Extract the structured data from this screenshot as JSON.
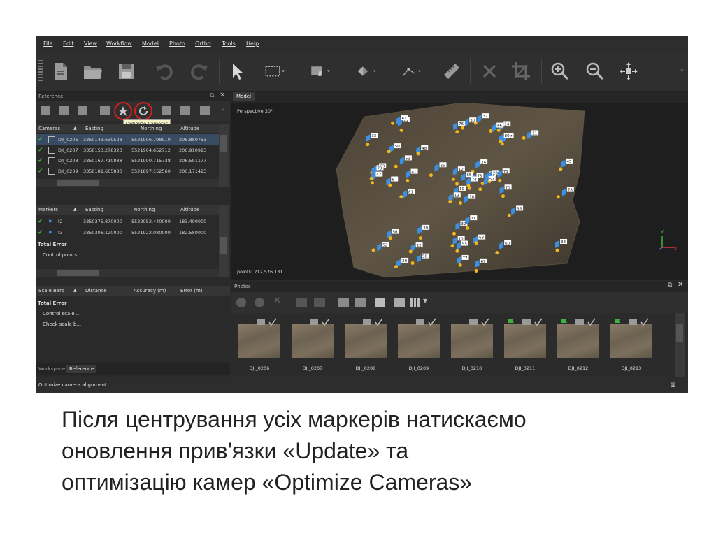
{
  "menu": [
    "File",
    "Edit",
    "View",
    "Workflow",
    "Model",
    "Photo",
    "Ortho",
    "Tools",
    "Help"
  ],
  "toolbar": {
    "icons": [
      "new-document-icon",
      "open-folder-icon",
      "save-icon",
      "undo-icon",
      "redo-icon",
      "navigation-arrow-icon",
      "rectangle-selection-icon",
      "intelligent-scissors-icon",
      "move-object-icon",
      "draw-polyline-icon",
      "ruler-icon",
      "delete-icon",
      "crop-icon",
      "zoom-in-icon",
      "zoom-out-icon",
      "reset-view-icon"
    ]
  },
  "reference_panel": {
    "title": "Reference",
    "tooltip": "Optimize Cameras",
    "cameras": {
      "headers": [
        "Cameras",
        "Easting",
        "Northing",
        "Altitude"
      ],
      "rows": [
        {
          "name": "DJI_0206",
          "easting": "3350143.639528",
          "northing": "5521906.798910",
          "altitude": "206.880753"
        },
        {
          "name": "DJI_0207",
          "easting": "3350153.278323",
          "northing": "5521904.652712",
          "altitude": "206.910923"
        },
        {
          "name": "DJI_0208",
          "easting": "3350167.710888",
          "northing": "5521900.715738",
          "altitude": "206.591177"
        },
        {
          "name": "DJI_0209",
          "easting": "3350181.665880",
          "northing": "5521897.152560",
          "altitude": "206.171423"
        }
      ]
    },
    "markers": {
      "headers": [
        "Markers",
        "Easting",
        "Northing",
        "Altitude"
      ],
      "rows": [
        {
          "name": "t2",
          "easting": "3350375.870000",
          "northing": "5522052.440000",
          "altitude": "183.400000"
        },
        {
          "name": "t3",
          "easting": "3350306.120000",
          "northing": "5521922.080000",
          "altitude": "182.580000"
        }
      ],
      "total_error": "Total Error",
      "control_points": "Control points"
    },
    "scalebars": {
      "headers": [
        "Scale Bars",
        "Distance",
        "Accuracy (m)",
        "Error (m)"
      ],
      "total_error": "Total Error",
      "control_scale": "Control scale ...",
      "check_scale": "Check scale b..."
    },
    "tabs": [
      "Workspace",
      "Reference"
    ]
  },
  "model": {
    "tab": "Model",
    "view_label": "Perspective 30°",
    "points": "points: 212,526,131",
    "axis_y": "y",
    "axis_x": "x",
    "camera_labels": [
      "18",
      "19",
      "15",
      "14",
      "17",
      "21",
      "6",
      "13",
      "20",
      "24",
      "25",
      "22",
      "23",
      "50",
      "47",
      "45",
      "10",
      "48",
      "39",
      "38",
      "37",
      "41",
      "58",
      "57",
      "55",
      "56",
      "33",
      "60",
      "61",
      "68",
      "30",
      "69",
      "11",
      "66",
      "65",
      "32",
      "36",
      "52",
      "53",
      "12",
      "73",
      "70",
      "77",
      "71",
      "69",
      "76",
      "75",
      "74",
      "79",
      "80",
      "81",
      "78"
    ]
  },
  "photos": {
    "title": "Photos",
    "items": [
      "DJI_0206",
      "DJI_0207",
      "DJI_0208",
      "DJI_0209",
      "DJI_0210",
      "DJI_0211",
      "DJI_0212",
      "DJI_0213"
    ]
  },
  "status": "Optimize camera alignment",
  "caption": {
    "line1": "Після центрування усіх маркерів натискаємо",
    "line2": "оновлення прив'язки «Update» та",
    "line3": "оптимізацію камер «Optimize Cameras»"
  }
}
